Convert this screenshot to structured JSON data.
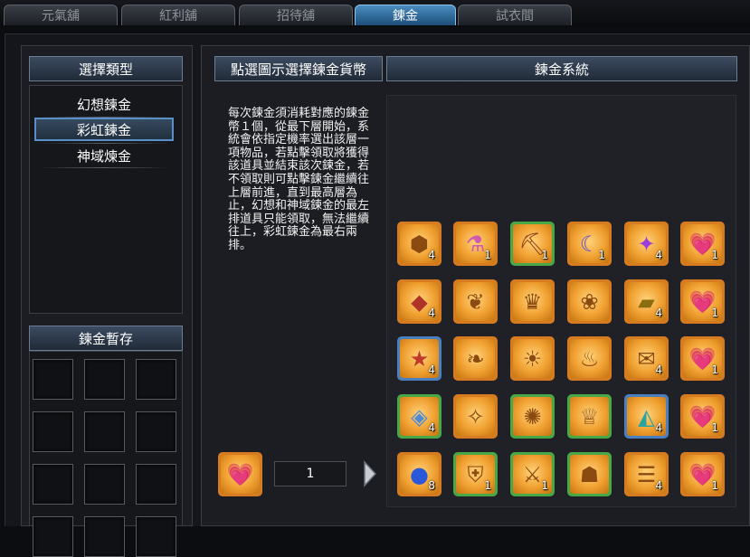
{
  "tabs": [
    {
      "label": "元氣舖",
      "active": false
    },
    {
      "label": "紅利舖",
      "active": false
    },
    {
      "label": "招待舖",
      "active": false
    },
    {
      "label": "鍊金",
      "active": true
    },
    {
      "label": "試衣間",
      "active": false
    }
  ],
  "left": {
    "type_header": "選擇類型",
    "types": [
      {
        "label": "幻想鍊金",
        "selected": false
      },
      {
        "label": "彩虹鍊金",
        "selected": true
      },
      {
        "label": "神域煉金",
        "selected": false
      }
    ],
    "storage_header": "鍊金暫存"
  },
  "middle": {
    "currency_header": "點選圖示選擇鍊金貨幣",
    "description": "每次鍊金須消耗對應的鍊金幣１個，從最下層開始，系統會依指定機率選出該層一項物品，若點擊領取將獲得該道具並結束該次鍊金，若不領取則可點擊鍊金繼續往上層前進，直到最高層為止，幻想和神域鍊金的最左排道具只能領取，無法繼續往上，彩虹鍊金為最右兩排。",
    "quantity": "1"
  },
  "right": {
    "header": "鍊金系統",
    "rows": [
      [
        {
          "icon": "hexagon-stone-icon",
          "count": "4",
          "rarity": "o"
        },
        {
          "icon": "potion-bottle-icon",
          "count": "1",
          "rarity": "o"
        },
        {
          "icon": "pickaxe-icon",
          "count": "1",
          "rarity": "g"
        },
        {
          "icon": "moon-staff-icon",
          "count": "1",
          "rarity": "o"
        },
        {
          "icon": "purple-wing-icon",
          "count": "4",
          "rarity": "o"
        },
        {
          "icon": "rainbow-coin-icon",
          "count": "1",
          "rarity": "o"
        }
      ],
      [
        {
          "icon": "red-stone-icon",
          "count": "4",
          "rarity": "o"
        },
        {
          "icon": "golden-wing-icon",
          "count": "",
          "rarity": "o"
        },
        {
          "icon": "golden-crown-icon",
          "count": "",
          "rarity": "o"
        },
        {
          "icon": "angel-costume-icon",
          "count": "",
          "rarity": "o"
        },
        {
          "icon": "gold-card-icon",
          "count": "4",
          "rarity": "o"
        },
        {
          "icon": "rainbow-coin-icon",
          "count": "1",
          "rarity": "o"
        }
      ],
      [
        {
          "icon": "star-stone-icon",
          "count": "4",
          "rarity": "b"
        },
        {
          "icon": "silver-wing-icon",
          "count": "",
          "rarity": "o"
        },
        {
          "icon": "sun-emblem-icon",
          "count": "",
          "rarity": "o"
        },
        {
          "icon": "hair-style-icon",
          "count": "",
          "rarity": "o"
        },
        {
          "icon": "scroll-icon",
          "count": "4",
          "rarity": "o"
        },
        {
          "icon": "rainbow-coin-icon",
          "count": "1",
          "rarity": "o"
        }
      ],
      [
        {
          "icon": "blue-stone-icon",
          "count": "4",
          "rarity": "g"
        },
        {
          "icon": "crystal-wing-icon",
          "count": "",
          "rarity": "o"
        },
        {
          "icon": "sun-ring-icon",
          "count": "",
          "rarity": "g"
        },
        {
          "icon": "dress-icon",
          "count": "",
          "rarity": "g"
        },
        {
          "icon": "prism-card-icon",
          "count": "4",
          "rarity": "b"
        },
        {
          "icon": "rainbow-coin-icon",
          "count": "1",
          "rarity": "o"
        }
      ],
      [
        {
          "icon": "blue-orb-icon",
          "count": "8",
          "rarity": "o"
        },
        {
          "icon": "ornate-shield-icon",
          "count": "1",
          "rarity": "g"
        },
        {
          "icon": "armor-set-icon",
          "count": "1",
          "rarity": "g"
        },
        {
          "icon": "cape-icon",
          "count": "",
          "rarity": "g"
        },
        {
          "icon": "document-icon",
          "count": "4",
          "rarity": "o"
        },
        {
          "icon": "rainbow-coin-icon",
          "count": "1",
          "rarity": "o"
        }
      ]
    ]
  },
  "currency_icon": "rainbow-coin-icon",
  "colors": {
    "accent": "#3a79ad",
    "header_bg": "#2b384a",
    "item_bg": "#f0a030"
  }
}
